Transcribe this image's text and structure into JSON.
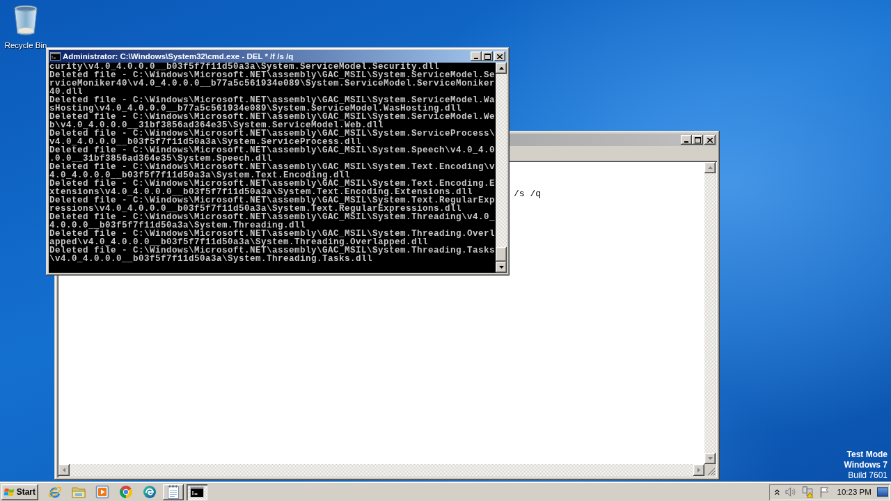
{
  "desktop": {
    "icons": [
      {
        "label": "Recycle Bin"
      }
    ],
    "notice": [
      {
        "text": "Test Mode",
        "bold": true
      },
      {
        "text": "Windows 7",
        "bold": true
      },
      {
        "text": "Build 7601",
        "bold": false
      }
    ]
  },
  "console_window": {
    "title": "Administrator: C:\\Windows\\System32\\cmd.exe - DEL * /f /s /q",
    "active": true,
    "lines": [
      "curity\\v4.0_4.0.0.0__b03f5f7f11d50a3a\\System.ServiceModel.Security.dll",
      "Deleted file - C:\\Windows\\Microsoft.NET\\assembly\\GAC_MSIL\\System.ServiceModel.Se",
      "rviceMoniker40\\v4.0_4.0.0.0__b77a5c561934e089\\System.ServiceModel.ServiceMoniker",
      "40.dll",
      "Deleted file - C:\\Windows\\Microsoft.NET\\assembly\\GAC_MSIL\\System.ServiceModel.Wa",
      "sHosting\\v4.0_4.0.0.0__b77a5c561934e089\\System.ServiceModel.WasHosting.dll",
      "Deleted file - C:\\Windows\\Microsoft.NET\\assembly\\GAC_MSIL\\System.ServiceModel.We",
      "b\\v4.0_4.0.0.0__31bf3856ad364e35\\System.ServiceModel.Web.dll",
      "Deleted file - C:\\Windows\\Microsoft.NET\\assembly\\GAC_MSIL\\System.ServiceProcess\\",
      "v4.0_4.0.0.0__b03f5f7f11d50a3a\\System.ServiceProcess.dll",
      "Deleted file - C:\\Windows\\Microsoft.NET\\assembly\\GAC_MSIL\\System.Speech\\v4.0_4.0",
      ".0.0__31bf3856ad364e35\\System.Speech.dll",
      "Deleted file - C:\\Windows\\Microsoft.NET\\assembly\\GAC_MSIL\\System.Text.Encoding\\v",
      "4.0_4.0.0.0__b03f5f7f11d50a3a\\System.Text.Encoding.dll",
      "Deleted file - C:\\Windows\\Microsoft.NET\\assembly\\GAC_MSIL\\System.Text.Encoding.E",
      "xtensions\\v4.0_4.0.0.0__b03f5f7f11d50a3a\\System.Text.Encoding.Extensions.dll",
      "Deleted file - C:\\Windows\\Microsoft.NET\\assembly\\GAC_MSIL\\System.Text.RegularExp",
      "ressions\\v4.0_4.0.0.0__b03f5f7f11d50a3a\\System.Text.RegularExpressions.dll",
      "Deleted file - C:\\Windows\\Microsoft.NET\\assembly\\GAC_MSIL\\System.Threading\\v4.0_",
      "4.0.0.0__b03f5f7f11d50a3a\\System.Threading.dll",
      "Deleted file - C:\\Windows\\Microsoft.NET\\assembly\\GAC_MSIL\\System.Threading.Overl",
      "apped\\v4.0_4.0.0.0__b03f5f7f11d50a3a\\System.Threading.Overlapped.dll",
      "Deleted file - C:\\Windows\\Microsoft.NET\\assembly\\GAC_MSIL\\System.Threading.Tasks",
      "\\v4.0_4.0.0.0__b03f5f7f11d50a3a\\System.Threading.Tasks.dll"
    ]
  },
  "editor_window": {
    "active": false,
    "text": "/s /q"
  },
  "taskbar": {
    "start": "Start",
    "items": [
      {
        "running": false,
        "selected": false
      },
      {
        "running": false,
        "selected": false
      },
      {
        "running": false,
        "selected": false
      },
      {
        "running": false,
        "selected": false
      },
      {
        "running": false,
        "selected": false
      },
      {
        "running": true,
        "selected": false
      },
      {
        "running": true,
        "selected": true
      }
    ],
    "clock": "10:23 PM"
  }
}
